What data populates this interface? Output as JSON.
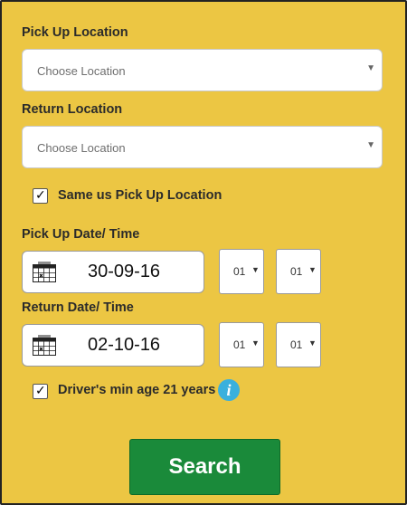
{
  "pickup": {
    "label": "Pick Up Location",
    "placeholder": "Choose Location",
    "arrow": "▼"
  },
  "return": {
    "label": "Return Location",
    "placeholder": "Choose Location",
    "arrow": "▼"
  },
  "same_location": {
    "label": "Same us Pick Up Location",
    "checked": true,
    "mark": "✓"
  },
  "pickup_datetime": {
    "label": "Pick Up Date/ Time",
    "date": "30-09-16",
    "hour": "01",
    "minute": "01",
    "arrow": "▼"
  },
  "return_datetime": {
    "label": "Return Date/ Time",
    "date": "02-10-16",
    "hour": "01",
    "minute": "01",
    "arrow": "▼"
  },
  "min_age": {
    "label": "Driver's min age 21 years",
    "checked": true,
    "mark": "✓",
    "info_glyph": "i"
  },
  "search_label": "Search",
  "colors": {
    "panel": "#ecc643",
    "search_button": "#1a8a3a",
    "info_icon": "#3ab0dd"
  },
  "icons": [
    "calendar-icon",
    "info-icon",
    "checkmark-icon",
    "dropdown-arrow-icon"
  ]
}
